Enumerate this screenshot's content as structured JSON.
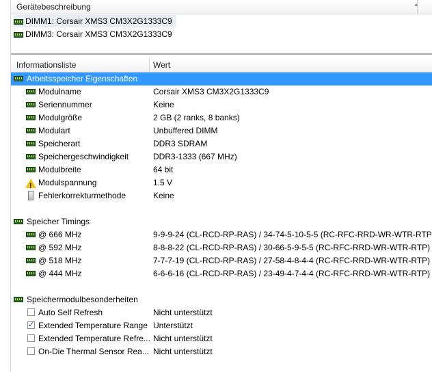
{
  "device_panel": {
    "header": "Gerätebeschreibung",
    "items": [
      {
        "label": "DIMM1: Corsair XMS3 CM3X2G1333C9",
        "selected": true
      },
      {
        "label": "DIMM3: Corsair XMS3 CM3X2G1333C9",
        "selected": false
      }
    ]
  },
  "info_panel": {
    "columns": [
      "Informationsliste",
      "Wert"
    ],
    "sections": [
      {
        "title": "Arbeitsspeicher Eigenschaften",
        "rows": [
          {
            "icon": "memory-module-icon",
            "label": "Modulname",
            "value": "Corsair XMS3 CM3X2G1333C9"
          },
          {
            "icon": "memory-module-icon",
            "label": "Seriennummer",
            "value": "Keine"
          },
          {
            "icon": "memory-module-icon",
            "label": "Modulgröße",
            "value": "2 GB (2 ranks, 8 banks)"
          },
          {
            "icon": "memory-module-icon",
            "label": "Modulart",
            "value": "Unbuffered DIMM"
          },
          {
            "icon": "memory-module-icon",
            "label": "Speicherart",
            "value": "DDR3 SDRAM"
          },
          {
            "icon": "memory-module-icon",
            "label": "Speichergeschwindigkeit",
            "value": "DDR3-1333 (667 MHz)"
          },
          {
            "icon": "memory-module-icon",
            "label": "Modulbreite",
            "value": "64 bit"
          },
          {
            "icon": "warning-icon",
            "label": "Modulspannung",
            "value": "1.5 V"
          },
          {
            "icon": "server-icon",
            "label": "Fehlerkorrekturmethode",
            "value": "Keine"
          }
        ]
      },
      {
        "title": "Speicher Timings",
        "rows": [
          {
            "icon": "memory-module-icon",
            "label": "@ 666 MHz",
            "value": "9-9-9-24  (CL-RCD-RP-RAS) / 34-74-5-10-5-5  (RC-RFC-RRD-WR-WTR-RTP)"
          },
          {
            "icon": "memory-module-icon",
            "label": "@ 592 MHz",
            "value": "8-8-8-22  (CL-RCD-RP-RAS) / 30-66-5-9-5-5  (RC-RFC-RRD-WR-WTR-RTP)"
          },
          {
            "icon": "memory-module-icon",
            "label": "@ 518 MHz",
            "value": "7-7-7-19  (CL-RCD-RP-RAS) / 27-58-4-8-4-4  (RC-RFC-RRD-WR-WTR-RTP)"
          },
          {
            "icon": "memory-module-icon",
            "label": "@ 444 MHz",
            "value": "6-6-6-16  (CL-RCD-RP-RAS) / 23-49-4-7-4-4  (RC-RFC-RRD-WR-WTR-RTP)"
          }
        ]
      },
      {
        "title": "Speichermodulbesonderheiten",
        "rows": [
          {
            "icon": "checkbox",
            "checked": false,
            "label": "Auto Self Refresh",
            "value": "Nicht unterstützt"
          },
          {
            "icon": "checkbox",
            "checked": true,
            "label": "Extended Temperature Range",
            "value": "Unterstützt"
          },
          {
            "icon": "checkbox",
            "checked": false,
            "label": "Extended Temperature Refre...",
            "value": "Nicht unterstützt"
          },
          {
            "icon": "checkbox",
            "checked": false,
            "label": "On-Die Thermal Sensor Rea...",
            "value": "Nicht unterstützt"
          }
        ]
      }
    ]
  }
}
